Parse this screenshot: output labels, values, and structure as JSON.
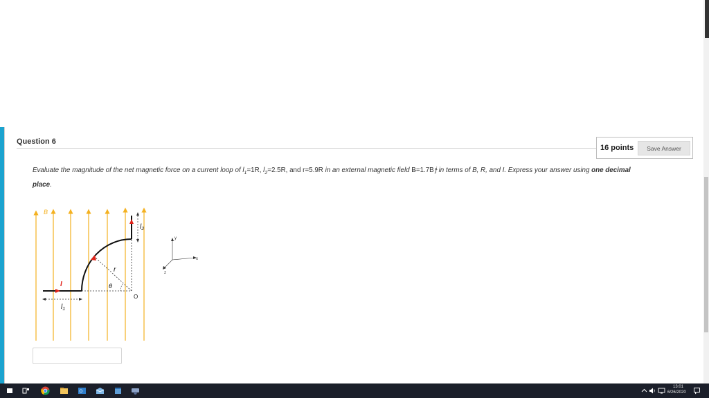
{
  "question": {
    "title": "Question 6",
    "points": "16 points",
    "save_label": "Save Answer",
    "text_part1": "Evaluate the magnitude of the net magnetic force on a current loop of ",
    "l1_sym": "l",
    "l1_sub": "1",
    "l1_val": "=1R, ",
    "l2_sym": "l",
    "l2_sub": "2",
    "l2_val": "=2.5R, and r=5.9R",
    "text_part2": " in an external magnetic field ",
    "b_vec": "B",
    "field_val": "=1.7B",
    "j_hat": "j",
    "text_part3": " in terms of B, R, and I. Express your answer using ",
    "emphasis": "one decimal",
    "emphasis2": "place",
    "period": "."
  },
  "diagram": {
    "b_label": "B",
    "current_label": "I",
    "r_label": "r",
    "theta_label": "θ",
    "origin_label": "O",
    "l1_label": "l",
    "l1_sub": "1",
    "l2_label": "l",
    "l2_sub": "2",
    "axis_y": "y",
    "axis_x": "x",
    "axis_z": "z"
  },
  "taskbar": {
    "time": "13:01",
    "date": "6/26/2020"
  },
  "colors": {
    "accent": "#1ba3cf",
    "field_lines": "#f4b120",
    "current_arrows": "#e2231a"
  },
  "icons": [
    "windows-start-icon",
    "task-view-icon",
    "chrome-icon",
    "file-explorer-icon",
    "outlook-icon",
    "mail-icon",
    "calendar-icon",
    "teams-icon",
    "network-icon",
    "volume-icon",
    "notification-icon"
  ]
}
